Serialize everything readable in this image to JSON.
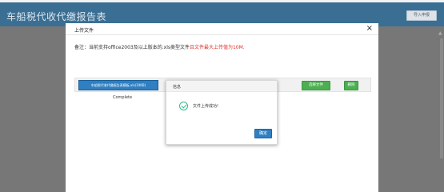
{
  "page": {
    "title": "车船税代收代缴报告表",
    "import_button": "导入申报"
  },
  "upload_dialog": {
    "title": "上传文件",
    "close": "×",
    "notice_prefix": "备注：当前支持office2003及以上版本的.xls类型文件",
    "notice_limit": "且文件最大上传值为10M.",
    "file": {
      "name": "车船税代收代缴报告表模板.xls(10KB)",
      "status": "成功",
      "count": "1",
      "progress_label": "Complete",
      "progress": 1.0
    },
    "choose_file_button": "选择文件",
    "delete_button": "删除"
  },
  "info_dialog": {
    "title": "信息",
    "message": "文件上传成功!",
    "ok_button": "确定"
  },
  "colors": {
    "header": "#3a6f93",
    "progress": "#2f7fc1",
    "green_button": "#4caf50",
    "warning_text": "#e0322b",
    "success_icon": "#2bbd86"
  }
}
